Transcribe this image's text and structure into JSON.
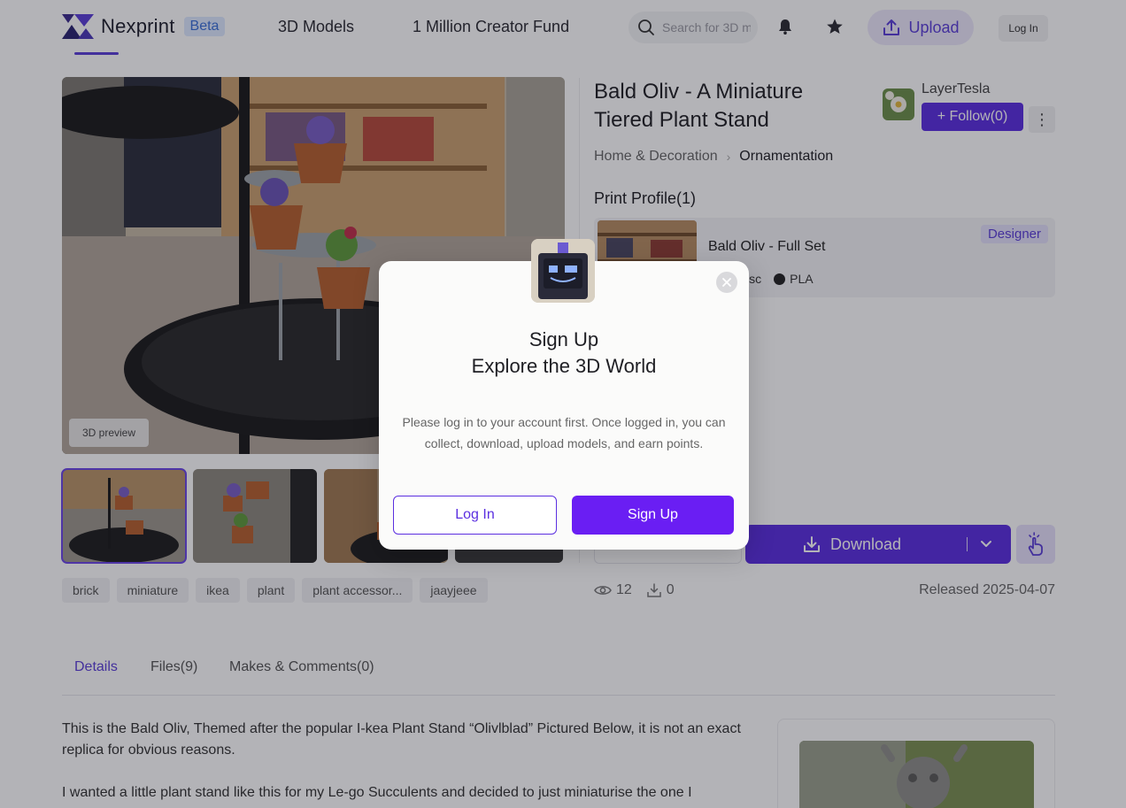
{
  "header": {
    "brand": "Nexprint",
    "beta_label": "Beta",
    "nav": [
      "3D Models",
      "1 Million Creator Fund"
    ],
    "search_placeholder": "Search for 3D m",
    "upload_label": "Upload",
    "login_label": "Log In",
    "icons": [
      "bell-icon",
      "star-icon",
      "upload-icon",
      "search-icon"
    ]
  },
  "model": {
    "title": "Bald Oliv - A Miniature Tiered Plant Stand",
    "preview_label": "3D preview",
    "author": "LayerTesla",
    "follow_label": "+ Follow(0)",
    "more_label": "⋮",
    "breadcrumb": [
      "Home & Decoration",
      "Ornamentation"
    ],
    "print_profile_heading": "Print Profile(1)",
    "profile": {
      "name": "Bald Oliv - Full Set",
      "badge": "Designer",
      "meta_left": "isc",
      "material": "PLA"
    },
    "tags": [
      "brick",
      "miniature",
      "ikea",
      "plant",
      "plant accessor...",
      "jaayjeee"
    ],
    "download_label": "Download",
    "views": "12",
    "downloads": "0",
    "released": "Released 2025-04-07"
  },
  "tabs": [
    "Details",
    "Files(9)",
    "Makes & Comments(0)"
  ],
  "description": [
    "This is the Bald Oliv, Themed after the popular I-kea Plant Stand “Olivlblad” Pictured Below, it is not an exact replica for obvious reasons.",
    "I wanted a little plant stand like this for my Le-go Succulents and decided to just miniaturise the one I"
  ],
  "modal": {
    "title_line1": "Sign Up",
    "title_line2": "Explore the 3D World",
    "message": "Please log in to your account first. Once logged in, you can collect, download, upload models, and earn points.",
    "login_label": "Log In",
    "signup_label": "Sign Up"
  },
  "colors": {
    "accent": "#5b2fe0",
    "signup": "#6a1ef3",
    "badge_bg": "#e4e0fb",
    "beta_bg": "#dde9ff"
  }
}
